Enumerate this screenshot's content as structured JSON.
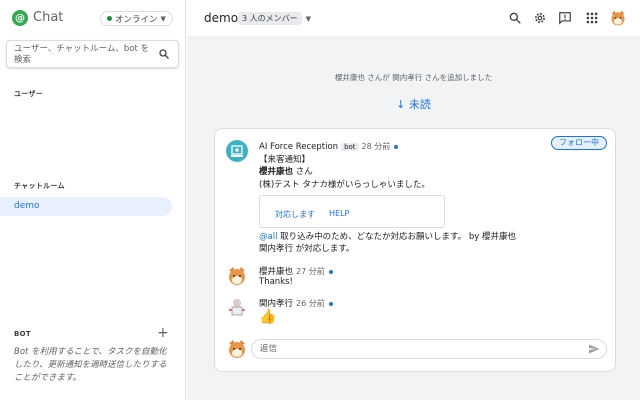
{
  "app": {
    "title": "Chat",
    "logo_icon": "chat-logo-icon",
    "accent": "#1a73e8"
  },
  "status": {
    "label": "オンライン",
    "color": "#1e8e3e"
  },
  "search": {
    "placeholder": "ユーザー、チャットルーム、bot を検索",
    "icon": "search-icon"
  },
  "sidebar": {
    "users_label": "ユーザー",
    "rooms_label": "チャットルーム",
    "rooms": [
      {
        "label": "demo",
        "selected": true
      }
    ],
    "bot_label": "BOT",
    "bot_description": "Bot を利用することで、タスクを自動化したり、更新通知を適時送信したりすることができます。"
  },
  "header": {
    "room_title": "demo",
    "member_count": "3 人のメンバー",
    "icons": [
      "search-icon",
      "settings-icon",
      "feedback-icon",
      "apps-grid-icon",
      "user-avatar"
    ]
  },
  "thread": {
    "reply_placeholder": "返信",
    "system_message": "櫻井康也 さんが 関内孝行 さんを追加しました",
    "unread_label": "↓ 未読"
  },
  "main_card": {
    "follow_label": "フォロー中",
    "bot_message": {
      "sender": "AI Force Reception",
      "badge": "bot",
      "time": "28 分前",
      "lines": [
        "【来客通知】",
        "櫻井康也",
        " さん",
        "(株)テスト タナカ様がいらっしゃいました。"
      ],
      "actions": [
        "対応します",
        "HELP"
      ],
      "followup_mention": "@all",
      "followup_text": " 取り込み中のため、どなたか対応お願いします。 by 櫻井康也",
      "followup_line2": "関内孝行 が対応します。"
    },
    "replies": [
      {
        "sender": "櫻井康也",
        "time": "27 分前",
        "text": "Thanks!"
      },
      {
        "sender": "関内孝行",
        "time": "26 分前",
        "text": "👍"
      }
    ],
    "reply_placeholder": "返信"
  }
}
